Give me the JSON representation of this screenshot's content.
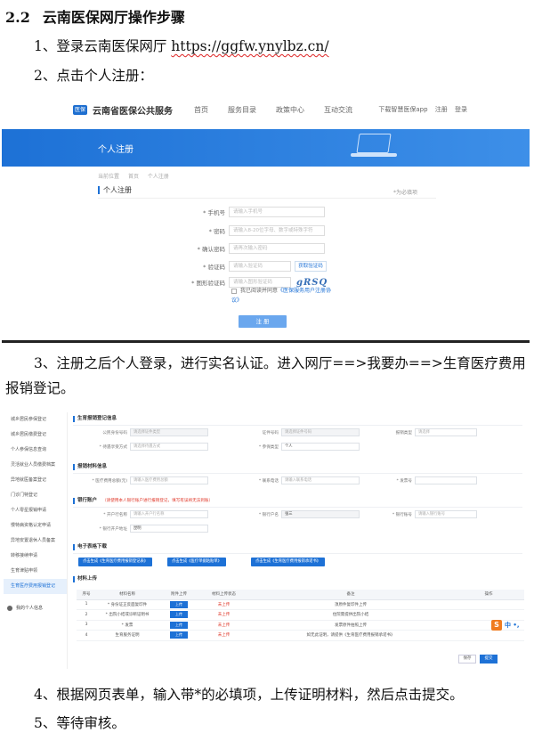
{
  "heading": {
    "number": "2.2",
    "title": "云南医保网厅操作步骤"
  },
  "steps": {
    "s1_text": "1、登录云南医保网厅 ",
    "s1_url": "https://ggfw.ynylbz.cn/",
    "s2": "2、点击个人注册：",
    "s3": "3、注册之后个人登录，进行实名认证。进入网厅==>我要办==>生育医疗费用报销登记。",
    "s4": "4、根据网页表单，输入带*的必填项，上传证明材料，然后点击提交。",
    "s5": "5、等待审核。"
  },
  "shot1": {
    "logo": "医保",
    "brand": "云南省医保公共服务",
    "nav": [
      "首页",
      "服务目录",
      "政策中心",
      "互动交流"
    ],
    "top_right": [
      "下载智慧医保app",
      "注册",
      "登录"
    ],
    "banner_title": "个人注册",
    "breadcrumb": [
      "当前位置",
      "首页",
      "个人注册"
    ],
    "section_title": "个人注册",
    "required_note": "*为必填项",
    "fields": [
      {
        "label": "* 手机号",
        "placeholder": "请输入手机号"
      },
      {
        "label": "* 密码",
        "placeholder": "请输入8-20位字母、数字或特殊字符"
      },
      {
        "label": "* 确认密码",
        "placeholder": "请再次输入密码"
      },
      {
        "label": "* 验证码",
        "placeholder": "请输入验证码"
      },
      {
        "label": "* 图形验证码",
        "placeholder": "请输入图形验证码"
      }
    ],
    "sms_button": "获取验证码",
    "captcha": "gRSQ",
    "agree_text": "我已阅读并同意",
    "agree_link": "《医保服务用户注册协议》",
    "submit": "注 册"
  },
  "shot2": {
    "sidebar": [
      "城乡居民参保登记",
      "城乡居民缴费登记",
      "个人参保信息查询",
      "灵活就业人员缴费档案",
      "异地就医备案登记",
      "门诊门特登记",
      "个人零星报销申请",
      "慢特病资格认定申请",
      "异地安置退休人员备案",
      "转移接续申请",
      "生育津贴申领",
      "生育医疗费用报销登记"
    ],
    "sidebar_active": 11,
    "sidebar_bottom": "我的个人信息",
    "sections": {
      "basic": "生育报销登记信息",
      "claim": "报销材料信息",
      "bank": "银行账户",
      "bank_warn": "（请使用本人银行账户进行报销登记，填写有误将无法到账）",
      "forms": "电子表格下载",
      "materials": "材料上传"
    },
    "basic_fields": [
      {
        "label": "公民身份号码",
        "value": "请选择证件类型"
      },
      {
        "label": "证件号码",
        "value": "请选择证件号码"
      },
      {
        "label": "报销类型",
        "value": "请选择"
      },
      {
        "label": "* 待遇享受方式",
        "value": "请选择待遇方式"
      },
      {
        "label": "* 参保类型",
        "value": "个人"
      }
    ],
    "claim_fields": [
      {
        "label": "* 医疗费用总额(元)",
        "value": "请输入医疗费用总额"
      },
      {
        "label": "* 联系电话",
        "value": "请输入联系电话"
      },
      {
        "label": "* 发票号",
        "value": ""
      }
    ],
    "bank_fields": [
      {
        "label": "* 开户行名称",
        "value": "请输入开户行名称"
      },
      {
        "label": "* 银行户名",
        "value": "张三"
      },
      {
        "label": "* 银行账号",
        "value": "请输入银行账号"
      },
      {
        "label": "* 银行开户地址",
        "value": "昆明"
      }
    ],
    "download_buttons": [
      "点击生成《生育医疗费用报销登记表》",
      "点击生成《医疗单据粘贴单》",
      "点击生成《生育医疗费用报销承诺书》"
    ],
    "table_headers": [
      "序号",
      "材料名称",
      "附件上传",
      "材料上传状态",
      "备注",
      "操作"
    ],
    "table_rows": [
      {
        "n": "1",
        "name": "* 身份证正反面复印件",
        "btn": "上传",
        "status": "未上传",
        "note": "须原件复印件上传"
      },
      {
        "n": "2",
        "name": "* 出院小结或诊断证明书",
        "btn": "上传",
        "status": "未上传",
        "note": "住院需提供出院小结"
      },
      {
        "n": "3",
        "name": "* 发票",
        "btn": "上传",
        "status": "未上传",
        "note": "发票原件拍照上传"
      },
      {
        "n": "4",
        "name": "生育服务证明",
        "btn": "上传",
        "status": "未上传",
        "note": "如无此证明，请提供《生育医疗费用报销承诺书》"
      }
    ],
    "sogou_text": "中 •,",
    "save": "保存",
    "submit": "提交"
  }
}
